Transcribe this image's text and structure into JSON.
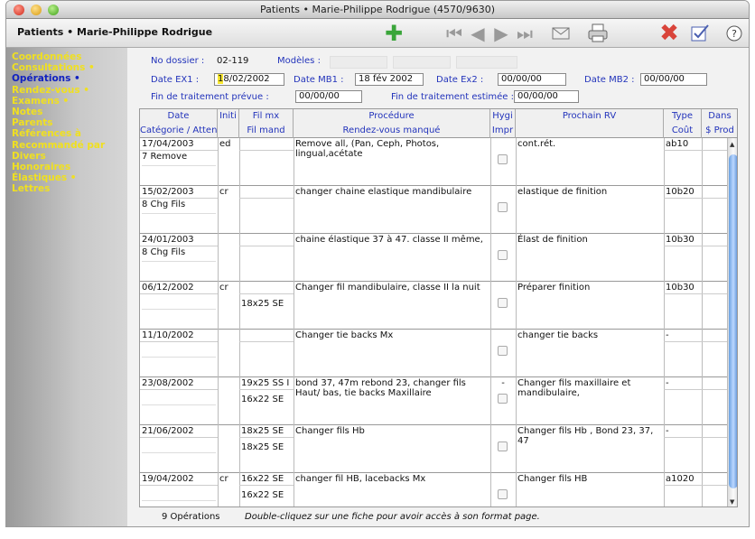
{
  "window": {
    "title": "Patients • Marie-Philippe Rodrigue (4570/9630)"
  },
  "toolbar": {
    "title": "Patients • Marie-Philippe Rodrigue"
  },
  "sidebar": {
    "items": [
      "Coordonnées",
      "Consultations •",
      "Opérations •",
      "Rendez-vous •",
      "Examens •",
      "Notes",
      "Parents",
      "Références à",
      "Recommandé par",
      "Divers",
      "Honoraires",
      "Élastiques •",
      "Lettres"
    ]
  },
  "form": {
    "dossier_label": "No dossier :",
    "dossier": "02-119",
    "modeles_label": "Modèles :",
    "ex1_label": "Date EX1 :",
    "ex1_cursor": "1",
    "ex1_rest": "8/02/2002",
    "mb1_label": "Date MB1 :",
    "mb1": "18 fév 2002",
    "ex2_label": "Date Ex2 :",
    "ex2": "00/00/00",
    "mb2_label": "Date MB2 :",
    "mb2": "00/00/00",
    "fin_prevue_label": "Fin de traitement prévue :",
    "fin_prevue": "00/00/00",
    "fin_estimee_label": "Fin de traitement estimée :",
    "fin_estimee": "00/00/00"
  },
  "table": {
    "headers": {
      "date": "Date",
      "categorie": "Catégorie  / Attention !",
      "initi": "Initi",
      "filmx": "Fil mx",
      "filmand": "Fil mand",
      "procedure": "Procédure",
      "rdv_manque": "Rendez-vous manqué",
      "hyg": "Hygi",
      "impr": "Impr",
      "prochain": "Prochain RV",
      "type": "Type",
      "cout": "Coût",
      "dans": "Dans",
      "prod": "$ Prod"
    },
    "rows": [
      {
        "date": "17/04/2003",
        "cat": "7 Remove",
        "init": "ed",
        "filmx": "",
        "filmand": "",
        "proc": "Remove all, (Pan, Ceph, Photos, lingual,acétate",
        "hyg": "",
        "next": "cont.rét.",
        "type": "ab10"
      },
      {
        "date": "15/02/2003",
        "cat": "8 Chg Fils",
        "init": "cr",
        "filmx": "",
        "filmand": "",
        "proc": "changer chaine elastique mandibulaire",
        "hyg": "",
        "next": "elastique de finition",
        "type": "10b20"
      },
      {
        "date": "24/01/2003",
        "cat": "8 Chg Fils",
        "init": "",
        "filmx": "",
        "filmand": "",
        "proc": "chaine élastique 37 à 47. classe II même,",
        "hyg": "",
        "next": "Élast de finition",
        "type": "10b30"
      },
      {
        "date": "06/12/2002",
        "cat": "",
        "init": "cr",
        "filmx": "",
        "filmand": "18x25 SE",
        "proc": "Changer fil mandibulaire, classe II la nuit",
        "hyg": "",
        "next": "Préparer finition",
        "type": "10b30"
      },
      {
        "date": "11/10/2002",
        "cat": "",
        "init": "",
        "filmx": "",
        "filmand": "",
        "proc": "Changer tie backs Mx",
        "hyg": "",
        "next": "changer tie backs",
        "type": "-"
      },
      {
        "date": "23/08/2002",
        "cat": "",
        "init": "",
        "filmx": "19x25 SS I",
        "filmand": "16x22 SE",
        "proc": "bond 37, 47m rebond 23, changer fils Haut/ bas, tie backs Maxillaire",
        "hyg": "-",
        "next": "Changer fils maxillaire et mandibulaire,",
        "type": "-"
      },
      {
        "date": "21/06/2002",
        "cat": "",
        "init": "",
        "filmx": "18x25 SE",
        "filmand": "18x25 SE",
        "proc": "Changer fils Hb",
        "hyg": "",
        "next": "Changer fils Hb , Bond 23, 37, 47",
        "type": "-"
      },
      {
        "date": "19/04/2002",
        "cat": "",
        "init": "cr",
        "filmx": "16x22 SE",
        "filmand": "16x22 SE",
        "proc": "changer fil HB, lacebacks Mx",
        "hyg": "",
        "next": "Changer fils HB",
        "type": "a1020"
      }
    ]
  },
  "footer": {
    "count": "9 Opérations",
    "hint": "Double-cliquez sur une fiche pour avoir accès à son format page."
  }
}
